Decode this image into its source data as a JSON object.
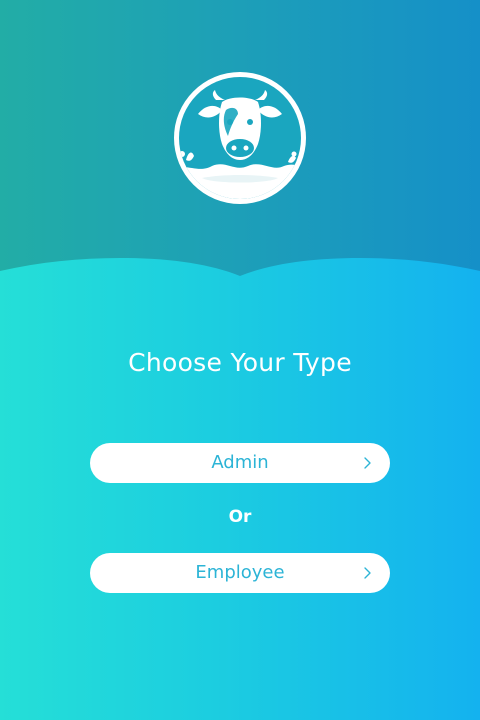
{
  "header": {
    "logo": {
      "icon": "cow-milk-splash-logo",
      "bg_color": "#1aa6bf",
      "ring_color": "#ffffff"
    }
  },
  "main": {
    "title": "Choose Your Type",
    "or_label": "Or",
    "buttons": [
      {
        "label": "Admin",
        "icon": "chevron-right-icon"
      },
      {
        "label": "Employee",
        "icon": "chevron-right-icon"
      }
    ]
  },
  "colors": {
    "header_gradient": [
      "#22ada6",
      "#1590c8"
    ],
    "body_gradient": [
      "#25dfd7",
      "#14b2ef"
    ],
    "button_text": "#2cb4d6",
    "button_bg": "#ffffff",
    "text": "#ffffff"
  }
}
